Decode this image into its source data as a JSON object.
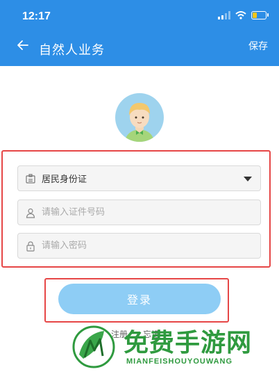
{
  "status_bar": {
    "time": "12:17"
  },
  "header": {
    "title": "自然人业务",
    "save_label": "保存"
  },
  "form": {
    "id_type_selected": "居民身份证",
    "id_number_placeholder": "请输入证件号码",
    "password_placeholder": "请输入密码"
  },
  "login_label": "登录",
  "links": {
    "register": "注册",
    "forgot": "忘记"
  },
  "watermark": {
    "title": "免费手游网",
    "subtitle": "MIANFEISHOUYOUWANG"
  },
  "colors": {
    "header_bg": "#2d8ee6",
    "login_button": "#8ecdf5",
    "highlight_border": "#e64646",
    "watermark": "#2f9a3f"
  }
}
